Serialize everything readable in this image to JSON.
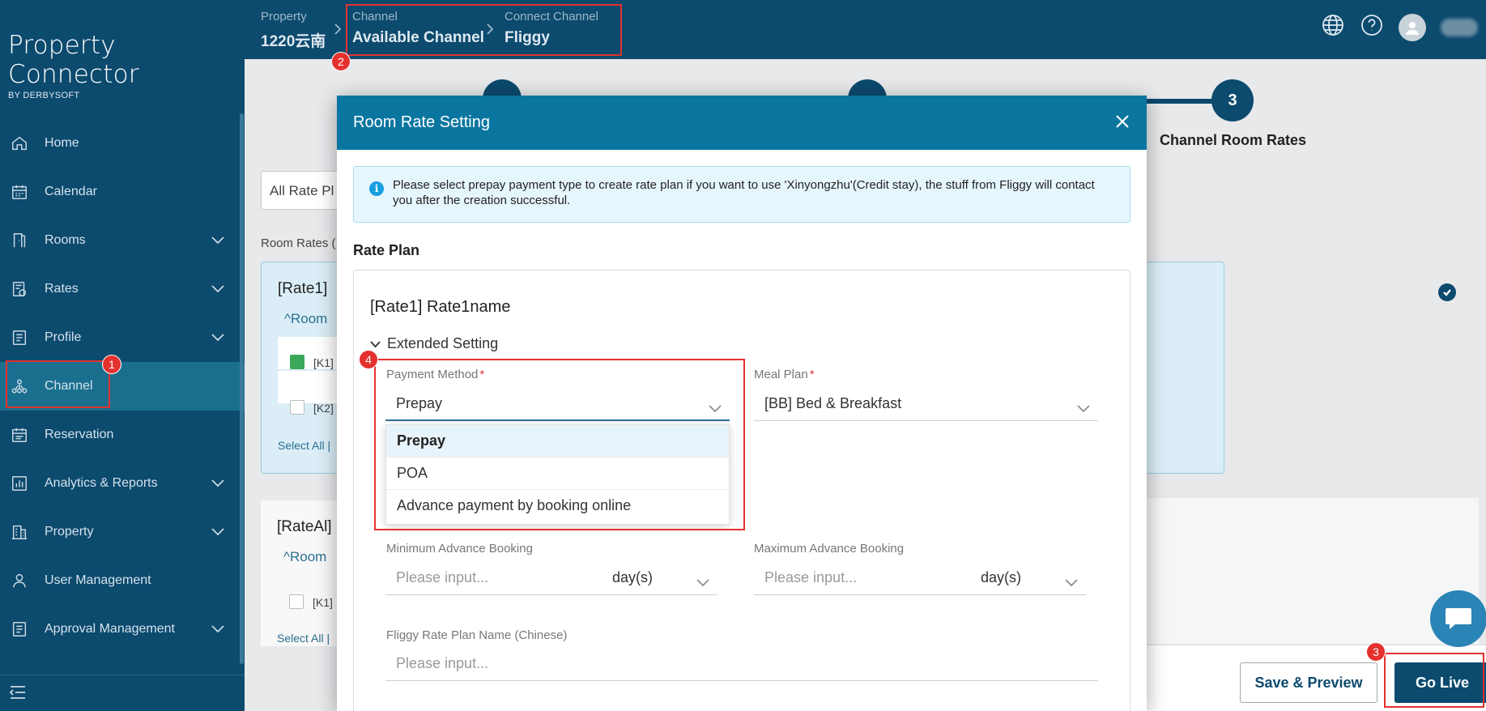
{
  "app": {
    "name": "Property Connector",
    "byline": "BY DERBYSOFT"
  },
  "sidebar": {
    "items": [
      {
        "label": "Home",
        "icon": "home-icon",
        "has_chevron": false
      },
      {
        "label": "Calendar",
        "icon": "calendar-icon",
        "has_chevron": false
      },
      {
        "label": "Rooms",
        "icon": "door-icon",
        "has_chevron": true
      },
      {
        "label": "Rates",
        "icon": "rates-icon",
        "has_chevron": true
      },
      {
        "label": "Profile",
        "icon": "profile-icon",
        "has_chevron": true
      },
      {
        "label": "Channel",
        "icon": "channel-icon",
        "has_chevron": false,
        "active": true
      },
      {
        "label": "Reservation",
        "icon": "reservation-icon",
        "has_chevron": false
      },
      {
        "label": "Analytics & Reports",
        "icon": "analytics-icon",
        "has_chevron": true
      },
      {
        "label": "Property",
        "icon": "building-icon",
        "has_chevron": true
      },
      {
        "label": "User Management",
        "icon": "user-icon",
        "has_chevron": false
      },
      {
        "label": "Approval Management",
        "icon": "approval-icon",
        "has_chevron": true
      }
    ]
  },
  "breadcrumb": {
    "property_label": "Property",
    "property_value": "1220云南",
    "channel_label": "Channel",
    "channel_value": "Available Channel",
    "connect_label": "Connect Channel",
    "connect_value": "Fliggy"
  },
  "topbar": {
    "icons": [
      "globe-icon",
      "help-icon",
      "avatar"
    ]
  },
  "background": {
    "step3_number": "3",
    "step3_label": "Channel Room Rates",
    "filter_text": "All Rate Pl",
    "room_rates_label": "Room Rates (",
    "card1_title": "[Rate1]",
    "card1_rooms": "^Room",
    "card1_row1": "[K1]",
    "card1_row2": "[K2]",
    "card1_select_all": "Select All  |",
    "card2_title": "[RateAl]",
    "card2_rooms": "^Room",
    "card2_row1": "[K1]",
    "card2_select_all": "Select All  |"
  },
  "footer": {
    "save_preview": "Save & Preview",
    "go_live": "Go Live"
  },
  "modal": {
    "title": "Room Rate Setting",
    "info": "Please select prepay payment type to create rate plan if you want to use 'Xinyongzhu'(Credit stay), the stuff from Fliggy will contact you after the creation successful.",
    "section_title": "Rate Plan",
    "rate_name": "[Rate1] Rate1name",
    "extended_setting": "Extended Setting",
    "payment_method": {
      "label": "Payment Method",
      "value": "Prepay",
      "options": [
        "Prepay",
        "POA",
        "Advance payment by booking online"
      ],
      "selected": "Prepay"
    },
    "meal_plan": {
      "label": "Meal Plan",
      "value": "[BB] Bed & Breakfast"
    },
    "min_advance": {
      "label": "Minimum Advance Booking",
      "placeholder": "Please input...",
      "unit": "day(s)"
    },
    "max_advance": {
      "label": "Maximum Advance Booking",
      "placeholder": "Please input...",
      "unit": "day(s)"
    },
    "fliggy_name": {
      "label": "Fliggy Rate Plan Name (Chinese)",
      "placeholder": "Please input..."
    }
  },
  "annotations": [
    "1",
    "2",
    "3",
    "4"
  ],
  "colors": {
    "sidebar": "#0c4a6e",
    "modal_header": "#0a76a0",
    "annotation": "#e5312f"
  }
}
